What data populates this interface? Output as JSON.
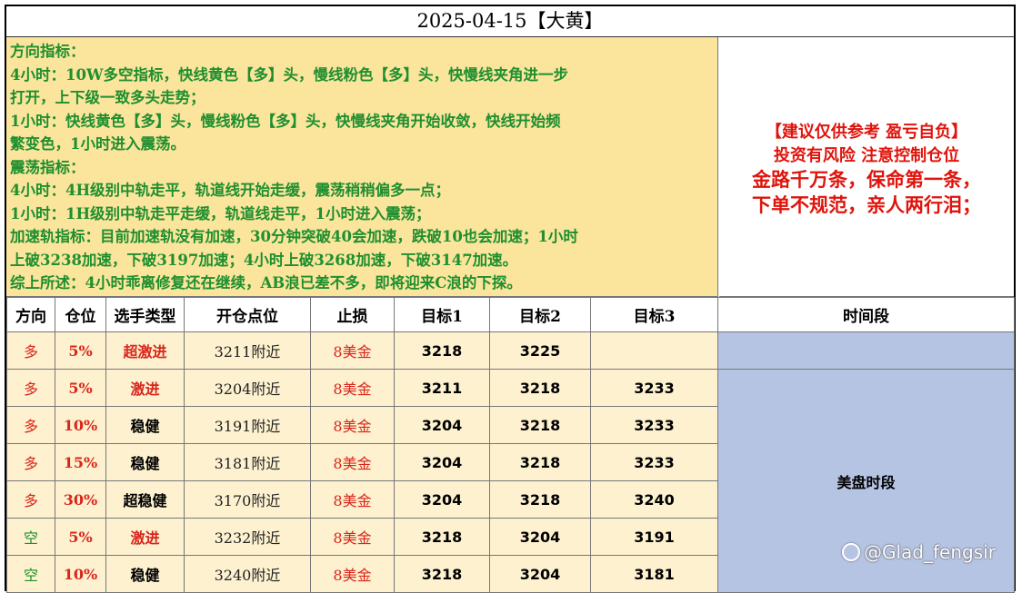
{
  "title": "2025-04-15【大黄】",
  "analysis": [
    "方向指标：",
    "4小时：10W多空指标，快线黄色【多】头，慢线粉色【多】头，快慢线夹角进一步",
    "打开，上下级一致多头走势；",
    "1小时：快线黄色【多】头，慢线粉色【多】头，快慢线夹角开始收敛，快线开始频",
    "繁变色，1小时进入震荡。",
    "震荡指标：",
    "4小时：4H级别中轨走平，轨道线开始走缓，震荡稍稍偏多一点；",
    "1小时：1H级别中轨走平走缓，轨道线走平，1小时进入震荡；",
    "加速轨指标：目前加速轨没有加速，30分钟突破40会加速，跌破10也会加速；1小时",
    "上破3238加速，下破3197加速；4小时上破3268加速，下破3147加速。",
    "综上所述：4小时乖离修复还在继续，AB浪已差不多，即将迎来C浪的下探。"
  ],
  "warning": {
    "line1": "【建议仅供参考 盈亏自负】",
    "line2": "投资有风险 注意控制仓位",
    "line3": "金路千万条，保命第一条，",
    "line4": "下单不规范，亲人两行泪；"
  },
  "table": {
    "headers": [
      "方向",
      "仓位",
      "选手类型",
      "开仓点位",
      "止损",
      "目标1",
      "目标2",
      "目标3",
      "时间段"
    ],
    "rows": [
      {
        "dir": "多",
        "pos": "5%",
        "type": "超激进",
        "entry": "3211附近",
        "stop": "8美金",
        "t1": "3218",
        "t2": "3225",
        "t3": ""
      },
      {
        "dir": "多",
        "pos": "5%",
        "type": "激进",
        "entry": "3204附近",
        "stop": "8美金",
        "t1": "3211",
        "t2": "3218",
        "t3": "3233"
      },
      {
        "dir": "多",
        "pos": "10%",
        "type": "稳健",
        "entry": "3191附近",
        "stop": "8美金",
        "t1": "3204",
        "t2": "3218",
        "t3": "3233"
      },
      {
        "dir": "多",
        "pos": "15%",
        "type": "稳健",
        "entry": "3181附近",
        "stop": "8美金",
        "t1": "3204",
        "t2": "3218",
        "t3": "3233"
      },
      {
        "dir": "多",
        "pos": "30%",
        "type": "超稳健",
        "entry": "3170附近",
        "stop": "8美金",
        "t1": "3204",
        "t2": "3218",
        "t3": "3240"
      },
      {
        "dir": "空",
        "pos": "5%",
        "type": "激进",
        "entry": "3232附近",
        "stop": "8美金",
        "t1": "3218",
        "t2": "3204",
        "t3": "3191"
      },
      {
        "dir": "空",
        "pos": "10%",
        "type": "稳健",
        "entry": "3240附近",
        "stop": "8美金",
        "t1": "3218",
        "t2": "3204",
        "t3": "3181"
      }
    ],
    "time_label": "美盘时段"
  },
  "watermark": "@Glad_fengsir",
  "colors": {
    "info_bg": "#fbe59c",
    "info_text": "#1f8f2f",
    "warn_text": "#e0140c",
    "row_bg": "#fdf1cf",
    "time_bg": "#b6c4e4"
  }
}
